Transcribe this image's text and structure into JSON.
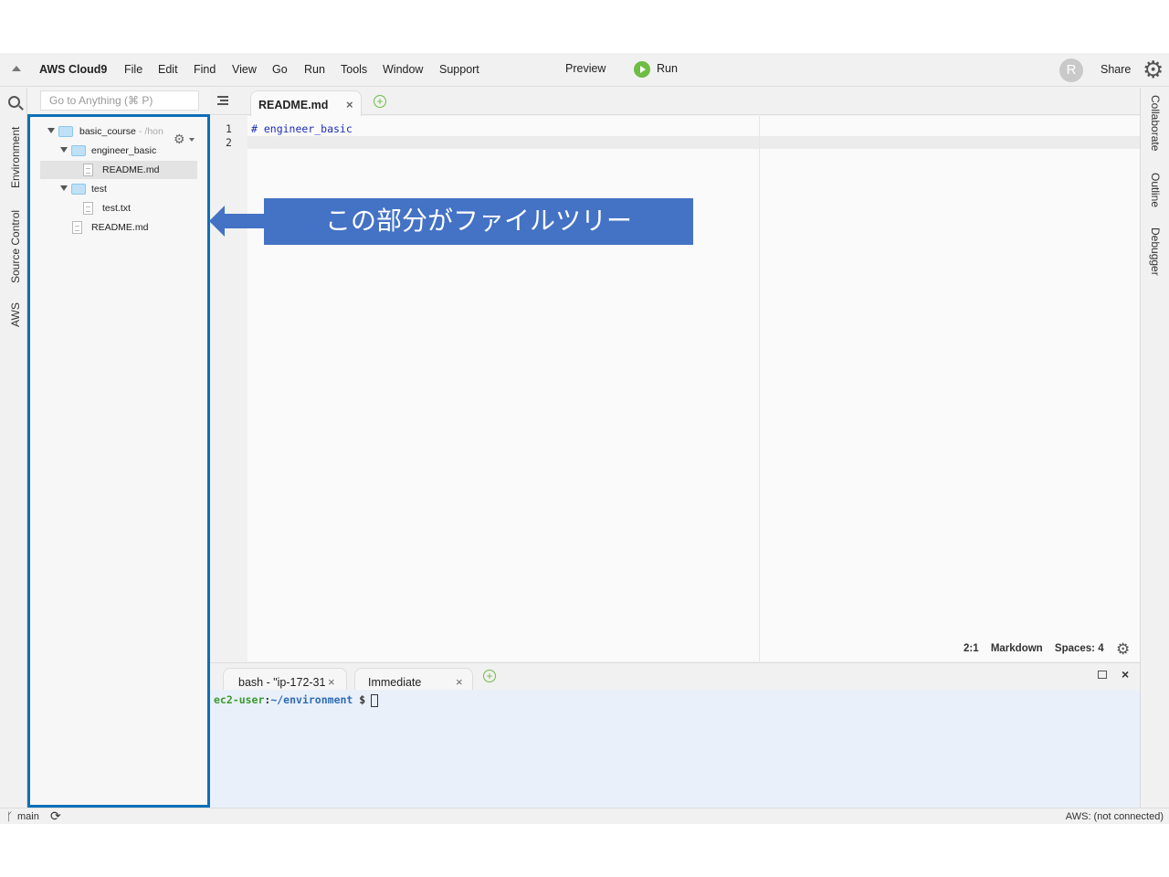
{
  "menubar": {
    "brand": "AWS Cloud9",
    "menus": [
      "File",
      "Edit",
      "Find",
      "View",
      "Go",
      "Run",
      "Tools",
      "Window",
      "Support"
    ],
    "preview": "Preview",
    "run": "Run",
    "avatar_letter": "R",
    "share": "Share"
  },
  "left_tabs": [
    "Environment",
    "Source Control",
    "AWS"
  ],
  "right_tabs": [
    "Collaborate",
    "Outline",
    "Debugger"
  ],
  "search": {
    "placeholder": "Go to Anything (⌘ P)"
  },
  "tree": {
    "root": {
      "name": "basic_course",
      "path_hint": "- /hon"
    },
    "items": [
      {
        "name": "engineer_basic",
        "type": "folder"
      },
      {
        "name": "README.md",
        "type": "file"
      },
      {
        "name": "test",
        "type": "folder"
      },
      {
        "name": "test.txt",
        "type": "file"
      },
      {
        "name": "README.md",
        "type": "file"
      }
    ]
  },
  "editor": {
    "tab_label": "README.md",
    "close_glyph": "×",
    "add_glyph": "+",
    "line_numbers": [
      "1",
      "2"
    ],
    "lines": [
      "# engineer_basic",
      ""
    ],
    "status": {
      "position": "2:1",
      "mode": "Markdown",
      "indent": "Spaces: 4"
    }
  },
  "terminal": {
    "tabs": [
      "bash - \"ip-172-31",
      "Immediate"
    ],
    "prompt_user": "ec2-user",
    "prompt_sep": ":",
    "prompt_path": "~/environment",
    "prompt_dollar": "$",
    "close_glyph": "×"
  },
  "bottom": {
    "branch": "main",
    "aws_status": "AWS: (not connected)"
  },
  "callout": {
    "text": "この部分がファイルツリー"
  },
  "colors": {
    "callout_bg": "#4472c4",
    "tree_outline": "#0d6fb8",
    "run_green": "#6ebd44",
    "terminal_bg": "#e9f0f9"
  }
}
